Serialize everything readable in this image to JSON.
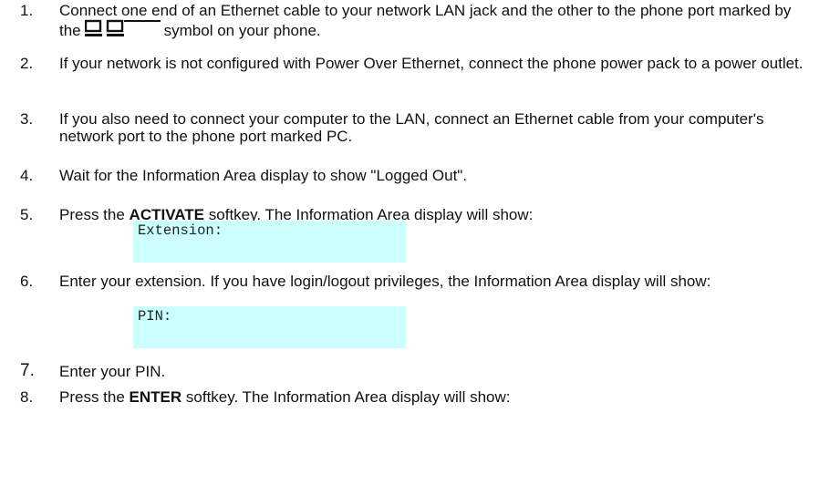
{
  "steps": [
    {
      "num": "1.",
      "text_before": "Connect one end of an Ethernet cable to your network LAN jack and the other to the phone port marked by the",
      "text_after": "symbol on your phone.",
      "icon": "network-port-icon"
    },
    {
      "num": "2.",
      "text": "If your network is not configured with Power Over Ethernet, connect the phone power pack to a power outlet."
    },
    {
      "num": "3.",
      "text": "If you also need to connect your computer to the LAN, connect an Ethernet cable from your computer's network port to the phone port marked PC."
    },
    {
      "num": "4.",
      "text": "Wait for the Information Area display to show \"Logged Out\"."
    },
    {
      "num": "5.",
      "text_before": "Press the",
      "bold": "ACTIVATE",
      "text_after": "softkey. The Information Area display will show:",
      "display": "Extension:"
    },
    {
      "num": "6.",
      "text": "Enter your extension. If you have login/logout privileges, the Information Area display will show:",
      "display": "PIN:"
    },
    {
      "num": "7.",
      "text": "Enter your PIN."
    },
    {
      "num": "8.",
      "text_before": "Press the",
      "bold": "ENTER",
      "text_after": "softkey. The Information Area display will show:"
    }
  ],
  "colors": {
    "display_background": "#ccffff",
    "text": "#111111"
  }
}
